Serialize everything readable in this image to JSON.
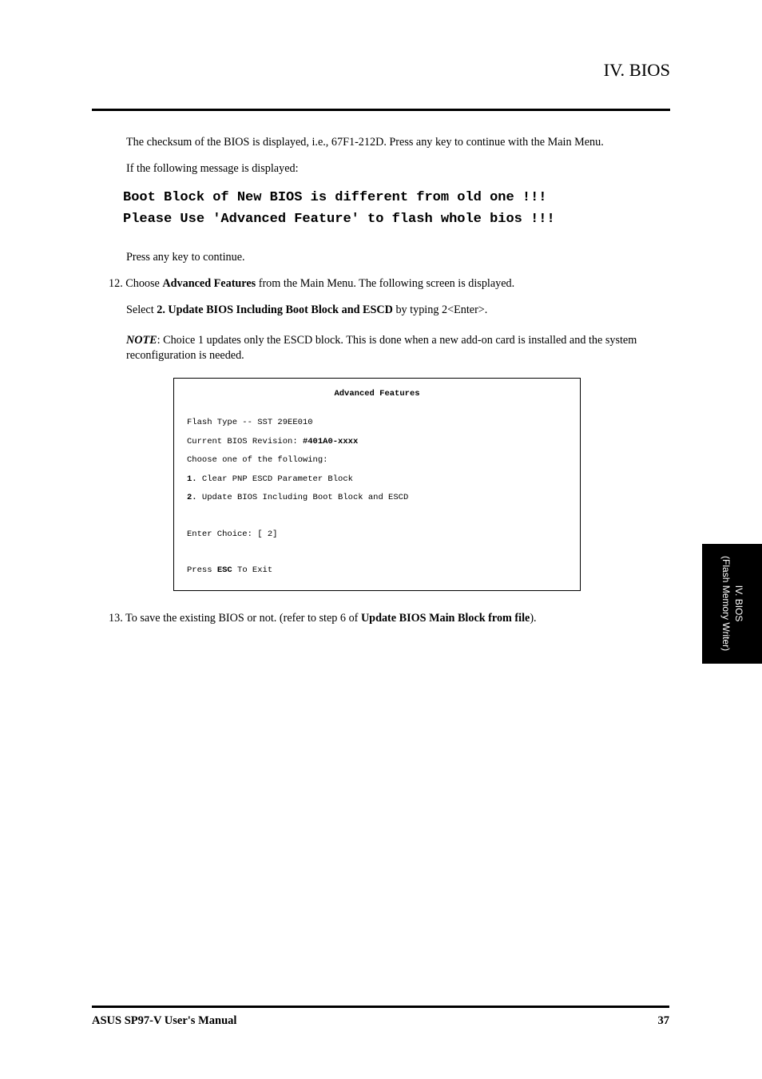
{
  "header": {
    "section_title": "IV. BIOS"
  },
  "content": {
    "para1": "The checksum of the BIOS is displayed, i.e., 67F1-212D. Press any key to continue with the Main Menu.",
    "para2": "If the following message is displayed:",
    "mono_warning_line1": "Boot Block of New BIOS is different from old one !!!",
    "mono_warning_line2": "Please Use 'Advanced Feature' to flash whole bios !!!",
    "para3": "Press any key to continue.",
    "para4_prefix": "Choose ",
    "para4_bold": "Advanced Features",
    "para4_suffix": " from the Main Menu. The following screen is displayed.",
    "para5_prefix": "Select ",
    "para5_bold": "2. Update BIOS Including Boot Block and ESCD",
    "para5_suffix": " by typing 2<Enter>.",
    "note_label": "NOTE",
    "note_text": ": Choice 1 updates only the ESCD block. This is done when a new add-on card is installed and the system reconfiguration is needed.",
    "para6_prefix": "13. To save the existing BIOS or not. (refer to step 6 of ",
    "para6_bold": "Update BIOS Main Block from file",
    "para6_suffix": ")."
  },
  "adv_box": {
    "title": "Advanced Features",
    "flash_type": "Flash Type -- SST 29EE010",
    "revision_label": "Current BIOS Revision: ",
    "revision_value": "#401A0-xxxx",
    "choose": "Choose one of the following:",
    "opt1_num": "1.",
    "opt1_text": " Clear PNP ESCD Parameter Block",
    "opt2_num": "2.",
    "opt2_text": " Update BIOS Including Boot Block and ESCD",
    "enter_choice": "Enter Choice: [ 2]",
    "press_label": "Press ",
    "press_key": "ESC",
    "press_suffix": " To Exit"
  },
  "side_tab": {
    "line1": "IV. BIOS",
    "line2": "(Flash Memory Writer)"
  },
  "footer": {
    "left": "ASUS SP97-V User's Manual",
    "right": "37"
  }
}
